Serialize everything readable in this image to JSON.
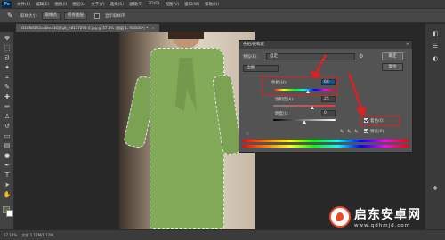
{
  "app": {
    "logo": "Ps",
    "menus": [
      "文件(F)",
      "编辑(E)",
      "图像(I)",
      "图层(L)",
      "文字(Y)",
      "选择(S)",
      "滤镜(T)",
      "3D(D)",
      "视图(V)",
      "窗口(W)",
      "帮助(H)"
    ]
  },
  "options_bar": {
    "sample_label": "取样大小:",
    "sample_value": "取样点",
    "sample_all_label": "所有图层",
    "show_ring_label": "显示取样环"
  },
  "document": {
    "tab_title": "O1CN01X3nsDmd1OjPqX_!!8137293-0.jpg @ 57.1% (图层 1, RGB/8#) *",
    "zoom": "57.14%",
    "doc_info": "文档:1.12M/1.12M"
  },
  "dialog": {
    "title": "色相/饱和度",
    "preset_label": "预设(E):",
    "preset_value": "自定",
    "channel_value": "全图",
    "hue_label": "色相(H):",
    "hue_value": "60",
    "saturation_label": "饱和度(A):",
    "saturation_value": "25",
    "lightness_label": "明度(I):",
    "lightness_value": "0",
    "ok_label": "确定",
    "reset_label": "复位",
    "colorize_label": "着色(O)",
    "preview_label": "预览(P)"
  },
  "watermark": {
    "cn": "启东安卓网",
    "url": "www.qdhmjd.com"
  },
  "colors": {
    "highlight": "#e02020",
    "dress_green": "#82aa58",
    "bg_dark": "#282828"
  }
}
